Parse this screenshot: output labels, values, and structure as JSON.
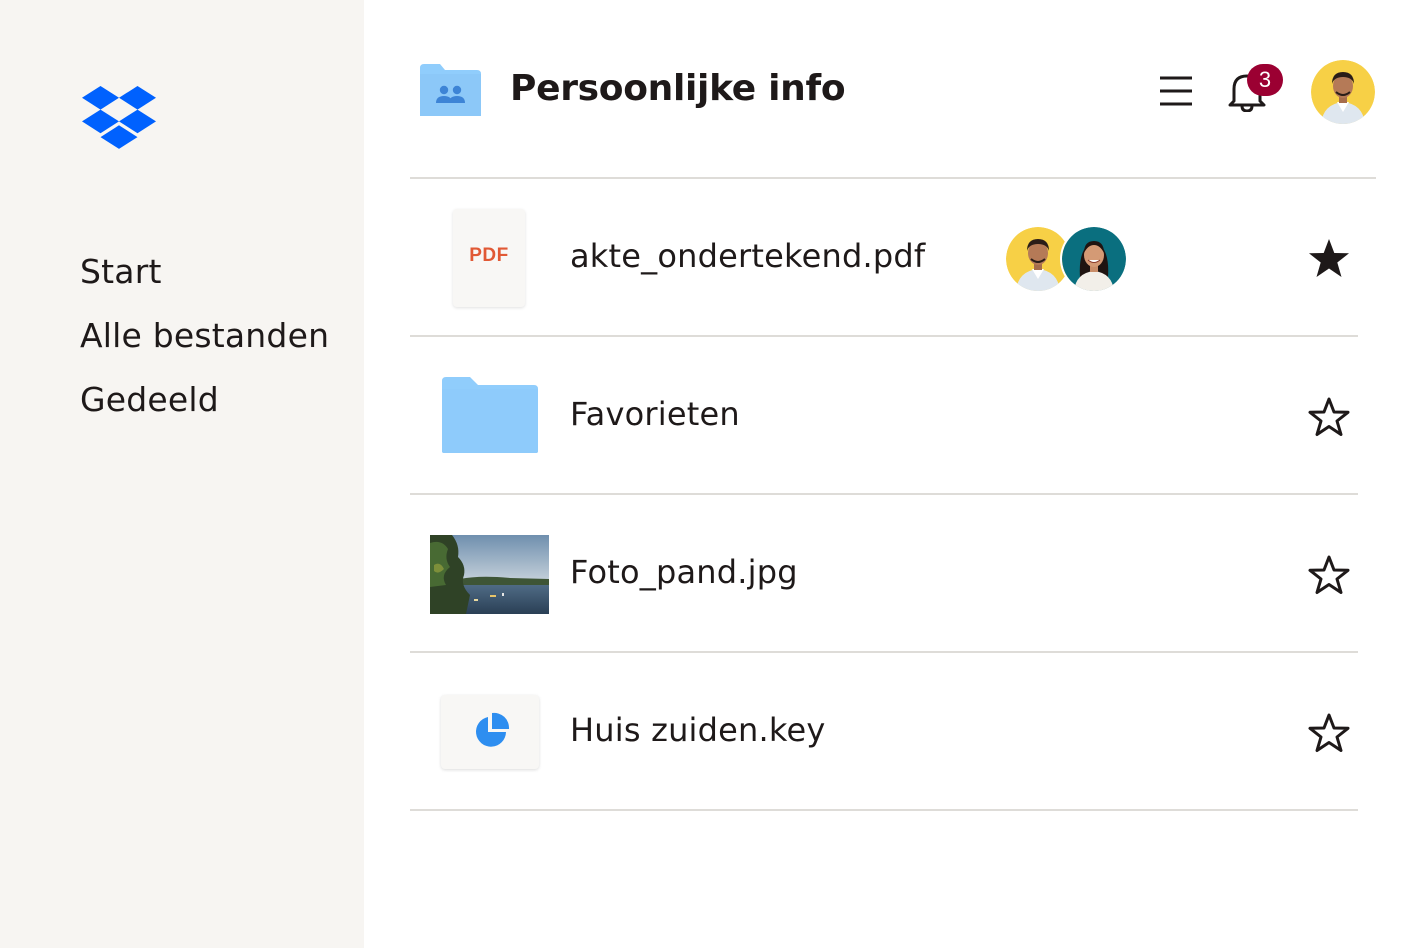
{
  "sidebar": {
    "items": [
      {
        "label": "Start"
      },
      {
        "label": "Alle bestanden"
      },
      {
        "label": "Gedeeld"
      }
    ]
  },
  "header": {
    "title": "Persoonlijke info",
    "notification_count": "3"
  },
  "files": [
    {
      "name": "akte_ondertekend.pdf",
      "type_label": "PDF",
      "starred": true,
      "shared_with": 2
    },
    {
      "name": "Favorieten",
      "starred": false
    },
    {
      "name": "Foto_pand.jpg",
      "starred": false
    },
    {
      "name": "Huis zuiden.key",
      "starred": false
    }
  ],
  "colors": {
    "brand_blue": "#0061fe",
    "folder_blue": "#90cdfc",
    "sidebar_bg": "#f7f5f2",
    "badge_red": "#9b0032",
    "pdf_orange": "#e15935",
    "avatar_yellow": "#f7d046",
    "avatar_teal": "#0a6f7f"
  },
  "icons": {
    "logo": "dropbox-logo",
    "menu": "hamburger-menu-icon",
    "bell": "bell-icon",
    "star_filled": "star-filled-icon",
    "star_outline": "star-outline-icon"
  }
}
